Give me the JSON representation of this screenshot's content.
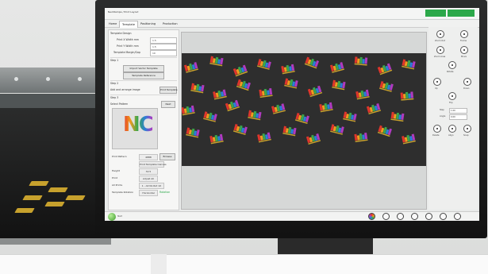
{
  "app": {
    "title": "NeoStampa / Print Layout",
    "window_button": "",
    "start_label": "Start"
  },
  "tabs": [
    {
      "label": "Home"
    },
    {
      "label": "Template"
    },
    {
      "label": "Positioning"
    },
    {
      "label": "Production"
    }
  ],
  "left_panel": {
    "section_a": {
      "label": "Template Design"
    },
    "rows": [
      {
        "label": "Print X Width mm",
        "value": "1.5"
      },
      {
        "label": "Print Y Width mm",
        "value": "1.5"
      },
      {
        "label": "Template Margin/Gap",
        "value": "10"
      }
    ],
    "step1": {
      "label": "Step 1"
    },
    "buttons_top": [
      {
        "label": "Import Vector Template"
      },
      {
        "label": "Template Reference"
      }
    ],
    "step2": {
      "label": "Step 2"
    },
    "step2_text": "Add and arrange image",
    "step2_button": "Print Template",
    "step3": {
      "label": "Step 3"
    },
    "select_label": "Select Pattern",
    "select_button": "Next",
    "properties": [
      {
        "label": "Print Pattern",
        "value": "4888",
        "button": "Browse"
      },
      {
        "label": "",
        "value": "Print Template Canvas",
        "button": ""
      },
      {
        "label": "Height",
        "value": "32.5",
        "button": ""
      },
      {
        "label": "Print",
        "value": "Adjust All",
        "button": ""
      },
      {
        "label": "All Prints",
        "value": "1 - All No Rot 1X",
        "button": ""
      },
      {
        "label": "Template Rotation",
        "value": "Horizontal",
        "button": "Rotation"
      }
    ]
  },
  "canvas": {
    "logo_text": "NC",
    "bed_color": "#2e2e2e"
  },
  "right_panel": {
    "buttons": [
      {
        "label": "Zoom Out"
      },
      {
        "label": "Frame"
      },
      {
        "label": "Zoom Area"
      },
      {
        "label": "Move"
      },
      {
        "label": "Rotate"
      },
      {
        "label": "Up"
      },
      {
        "label": "Down"
      },
      {
        "label": "Flip"
      },
      {
        "label": "Delete"
      },
      {
        "label": "Align"
      },
      {
        "label": "Snap"
      },
      {
        "label": "Grid"
      }
    ],
    "fields": [
      {
        "label": "Step",
        "value": "1.00"
      },
      {
        "label": "Angle",
        "value": "0.00"
      }
    ]
  },
  "bottom_bar": {
    "items": [
      {
        "label": "Color"
      },
      {
        "label": "Template"
      },
      {
        "label": "Import"
      },
      {
        "label": "Workspace"
      },
      {
        "label": "Export"
      },
      {
        "label": "Resources"
      },
      {
        "label": "Print"
      }
    ]
  },
  "colors": {
    "accent_green": "#2ca84a",
    "bed_print_yellow": "#c7a12d"
  }
}
